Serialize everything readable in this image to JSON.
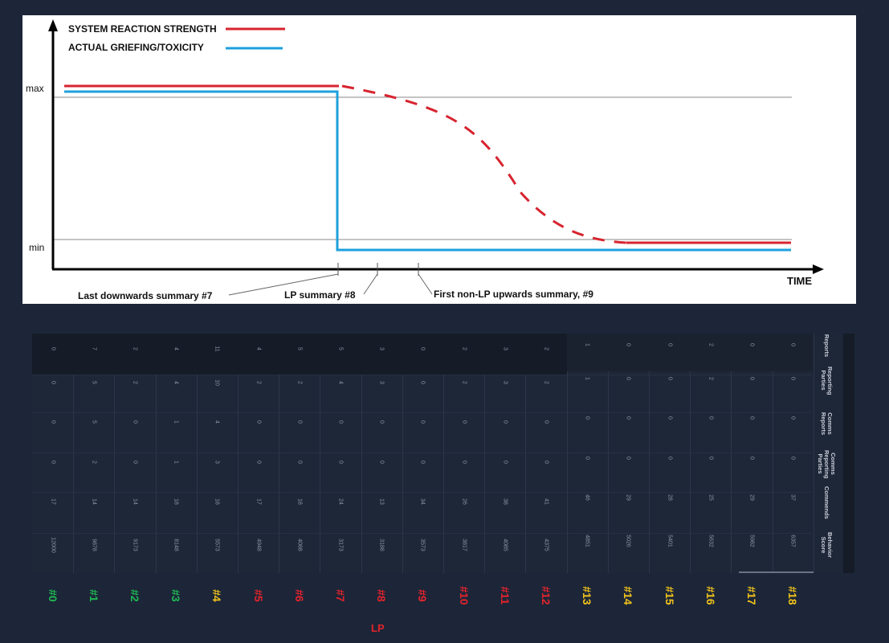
{
  "chart_data": {
    "type": "line",
    "legend": "top-left",
    "series": [
      {
        "name": "SYSTEM REACTION STRENGTH",
        "color": "#d7242f"
      },
      {
        "name": "ACTUAL GRIEFING/TOXICITY",
        "color": "#1ea0dc"
      }
    ],
    "y_ticks": [
      "max",
      "min"
    ],
    "xlabel": "TIME",
    "annotations": [
      "Last downwards summary #7",
      "LP summary #8",
      "First non-LP upwards summary, #9"
    ]
  },
  "table": {
    "row_labels": [
      "Reports",
      "Reporting Parties",
      "Comms Reports",
      "Comms Reporting Parties",
      "Commends",
      "Behavior Score"
    ],
    "columns": [
      {
        "label": "#0",
        "color": "#1fb854",
        "values": [
          "0",
          "0",
          "0",
          "0",
          "17",
          "12000"
        ]
      },
      {
        "label": "#1",
        "color": "#1fb854",
        "values": [
          "7",
          "5",
          "5",
          "2",
          "14",
          "9878"
        ]
      },
      {
        "label": "#2",
        "color": "#1fb854",
        "values": [
          "2",
          "2",
          "0",
          "0",
          "14",
          "9173"
        ]
      },
      {
        "label": "#3",
        "color": "#1fb854",
        "values": [
          "4",
          "4",
          "1",
          "1",
          "18",
          "8148"
        ]
      },
      {
        "label": "#4",
        "color": "#f2c31b",
        "values": [
          "11",
          "10",
          "4",
          "3",
          "18",
          "5573"
        ]
      },
      {
        "label": "#5",
        "color": "#e3232c",
        "values": [
          "4",
          "2",
          "0",
          "0",
          "17",
          "4948"
        ]
      },
      {
        "label": "#6",
        "color": "#e3232c",
        "values": [
          "5",
          "2",
          "0",
          "0",
          "18",
          "4088"
        ]
      },
      {
        "label": "#7",
        "color": "#e3232c",
        "values": [
          "5",
          "4",
          "0",
          "0",
          "24",
          "3173"
        ]
      },
      {
        "label": "#8",
        "color": "#e3232c",
        "values": [
          "3",
          "3",
          "0",
          "0",
          "13",
          "3188"
        ]
      },
      {
        "label": "#9",
        "color": "#e3232c",
        "values": [
          "0",
          "0",
          "0",
          "0",
          "34",
          "3573"
        ]
      },
      {
        "label": "#10",
        "color": "#e3232c",
        "values": [
          "2",
          "2",
          "0",
          "0",
          "26",
          "3817"
        ]
      },
      {
        "label": "#11",
        "color": "#e3232c",
        "values": [
          "3",
          "3",
          "0",
          "0",
          "38",
          "4085"
        ]
      },
      {
        "label": "#12",
        "color": "#e3232c",
        "values": [
          "2",
          "2",
          "0",
          "0",
          "41",
          "4375"
        ]
      },
      {
        "label": "#13",
        "color": "#f2c31b",
        "values": [
          "1",
          "1",
          "0",
          "0",
          "46",
          "4851"
        ]
      },
      {
        "label": "#14",
        "color": "#f2c31b",
        "values": [
          "0",
          "0",
          "0",
          "0",
          "29",
          "5026"
        ]
      },
      {
        "label": "#15",
        "color": "#f2c31b",
        "values": [
          "0",
          "0",
          "0",
          "0",
          "28",
          "5401"
        ]
      },
      {
        "label": "#16",
        "color": "#f2c31b",
        "values": [
          "2",
          "2",
          "0",
          "0",
          "25",
          "5632"
        ]
      },
      {
        "label": "#17",
        "color": "#f2c31b",
        "values": [
          "0",
          "0",
          "0",
          "0",
          "29",
          "5982"
        ]
      },
      {
        "label": "#18",
        "color": "#f2c31b",
        "values": [
          "0",
          "0",
          "0",
          "0",
          "37",
          "6357"
        ]
      }
    ],
    "lp_label": "LP"
  }
}
